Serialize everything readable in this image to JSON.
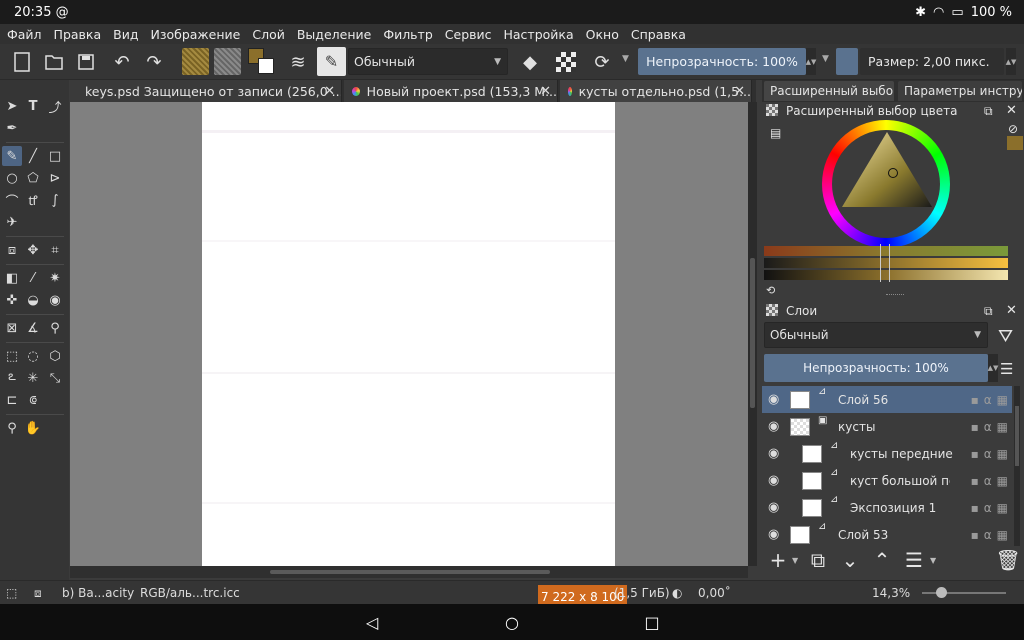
{
  "status": {
    "time": "20:35",
    "at": "@",
    "battery": "100 %"
  },
  "menu": [
    "Файл",
    "Правка",
    "Вид",
    "Изображение",
    "Слой",
    "Выделение",
    "Фильтр",
    "Сервис",
    "Настройка",
    "Окно",
    "Справка"
  ],
  "toolbar": {
    "blend_mode": "Обычный",
    "opacity": "Непрозрачность: 100%",
    "size": "Размер: 2,00 пикс.",
    "fg_color": "#8b6f2b",
    "bg_color": "#ffffff"
  },
  "tabs": [
    {
      "label": "keys.psd Защищено от записи  (256,0 ..."
    },
    {
      "label": "Новый проект.psd (153,3 М..."
    },
    {
      "label": "кусты отдельно.psd (1,5..."
    }
  ],
  "dock_tabs": [
    "Расширенный выбор...",
    "Параметры инстру..."
  ],
  "color_panel": {
    "title": "Расширенный выбор цвета"
  },
  "layers_panel": {
    "title": "Слои",
    "blend_mode": "Обычный",
    "opacity": "Непрозрачность:  100%",
    "layers": [
      {
        "name": "Слой 56"
      },
      {
        "name": "кусты"
      },
      {
        "name": "кусты передние"
      },
      {
        "name": "куст большой по..."
      },
      {
        "name": "Экспозиция 1"
      },
      {
        "name": "Слой 53"
      }
    ]
  },
  "app_status": {
    "brush": "b) Ba...acity",
    "profile": "RGB/аль...trc.icc",
    "dimensions": "7 222 x 8 100",
    "memory": "(1,5 ГиБ)",
    "rotation": "0,00˚",
    "zoom": "14,3%"
  }
}
